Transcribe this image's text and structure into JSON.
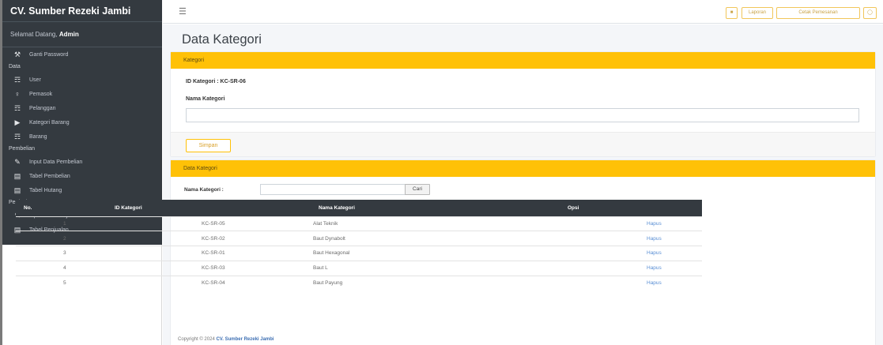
{
  "sidebar": {
    "brand": "CV. Sumber Rezeki Jambi",
    "welcome_prefix": "Selamat Datang,",
    "welcome_user": "Admin",
    "items": [
      {
        "type": "item",
        "label": "Ganti Password",
        "icon": "key-icon"
      },
      {
        "type": "header",
        "label": "Data"
      },
      {
        "type": "item",
        "label": "User",
        "icon": "users-icon"
      },
      {
        "type": "item",
        "label": "Pemasok",
        "icon": "user-icon"
      },
      {
        "type": "item",
        "label": "Pelanggan",
        "icon": "users-icon"
      },
      {
        "type": "item",
        "label": "Kategori Barang",
        "icon": "tag-icon"
      },
      {
        "type": "item",
        "label": "Barang",
        "icon": "users-icon"
      },
      {
        "type": "header",
        "label": "Pembelian"
      },
      {
        "type": "item",
        "label": "Input Data Pembelian",
        "icon": "pen-icon"
      },
      {
        "type": "item",
        "label": "Tabel Pembelian",
        "icon": "table-icon"
      },
      {
        "type": "item",
        "label": "Tabel Hutang",
        "icon": "table-icon"
      },
      {
        "type": "header",
        "label": "Penjualan"
      },
      {
        "type": "item",
        "label": "Input Data Penjualan",
        "icon": "pen-icon"
      },
      {
        "type": "item",
        "label": "Tabel Penjualan",
        "icon": "table-icon"
      }
    ]
  },
  "topbar": {
    "menu_icon": "hamburger-icon",
    "buttons": [
      {
        "label": "",
        "icon": "home-icon"
      },
      {
        "label": "Laporan"
      },
      {
        "label": "Cetak Pemesanan"
      },
      {
        "label": "",
        "icon": "logout-icon"
      }
    ]
  },
  "page": {
    "title": "Data Kategori"
  },
  "form_card": {
    "header": "Kategori",
    "id_label": "ID Kategori : KC-SR-06",
    "nama_label": "Nama Kategori",
    "nama_value": "",
    "submit_label": "Simpan"
  },
  "list_card": {
    "header": "Data Kategori",
    "search_label": "Nama Kategori :",
    "search_value": "",
    "search_button": "Cari",
    "columns": [
      "No.",
      "ID Kategori",
      "Nama Kategori",
      "Opsi"
    ],
    "rows": [
      {
        "no": "1",
        "id": "KC-SR-05",
        "nama": "Alat Teknik",
        "opsi": "Hapus"
      },
      {
        "no": "2",
        "id": "KC-SR-02",
        "nama": "Baut Dynabolt",
        "opsi": "Hapus"
      },
      {
        "no": "3",
        "id": "KC-SR-01",
        "nama": "Baut Hexagonal",
        "opsi": "Hapus"
      },
      {
        "no": "4",
        "id": "KC-SR-03",
        "nama": "Baut L",
        "opsi": "Hapus"
      },
      {
        "no": "5",
        "id": "KC-SR-04",
        "nama": "Baut Payung",
        "opsi": "Hapus"
      }
    ]
  },
  "footer": {
    "prefix": "Copyright © 2024",
    "company": "CV. Sumber Rezeki Jambi"
  },
  "colors": {
    "sidebar": "#343a40",
    "accent": "#ffc107",
    "link": "#5a8fd4"
  }
}
